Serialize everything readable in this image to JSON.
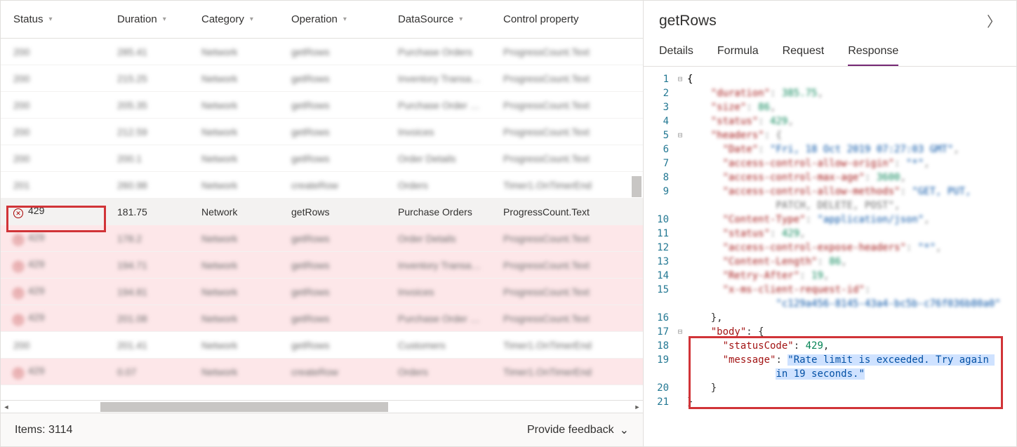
{
  "columns": {
    "status": "Status",
    "duration": "Duration",
    "category": "Category",
    "operation": "Operation",
    "datasource": "DataSource",
    "control": "Control property"
  },
  "rows": [
    {
      "status": "200",
      "duration": "285.41",
      "category": "Network",
      "operation": "getRows",
      "datasource": "Purchase Orders",
      "control": "ProgressCount.Text",
      "err": false,
      "sel": false,
      "blur": true
    },
    {
      "status": "200",
      "duration": "215.25",
      "category": "Network",
      "operation": "getRows",
      "datasource": "Inventory Transa…",
      "control": "ProgressCount.Text",
      "err": false,
      "sel": false,
      "blur": true
    },
    {
      "status": "200",
      "duration": "205.35",
      "category": "Network",
      "operation": "getRows",
      "datasource": "Purchase Order …",
      "control": "ProgressCount.Text",
      "err": false,
      "sel": false,
      "blur": true
    },
    {
      "status": "200",
      "duration": "212.59",
      "category": "Network",
      "operation": "getRows",
      "datasource": "Invoices",
      "control": "ProgressCount.Text",
      "err": false,
      "sel": false,
      "blur": true
    },
    {
      "status": "200",
      "duration": "200.1",
      "category": "Network",
      "operation": "getRows",
      "datasource": "Order Details",
      "control": "ProgressCount.Text",
      "err": false,
      "sel": false,
      "blur": true
    },
    {
      "status": "201",
      "duration": "260.98",
      "category": "Network",
      "operation": "createRow",
      "datasource": "Orders",
      "control": "Timer1.OnTimerEnd",
      "err": false,
      "sel": false,
      "blur": true
    },
    {
      "status": "429",
      "duration": "181.75",
      "category": "Network",
      "operation": "getRows",
      "datasource": "Purchase Orders",
      "control": "ProgressCount.Text",
      "err": true,
      "sel": true,
      "blur": false
    },
    {
      "status": "429",
      "duration": "178.2",
      "category": "Network",
      "operation": "getRows",
      "datasource": "Order Details",
      "control": "ProgressCount.Text",
      "err": true,
      "sel": false,
      "blur": true
    },
    {
      "status": "429",
      "duration": "194.71",
      "category": "Network",
      "operation": "getRows",
      "datasource": "Inventory Transa…",
      "control": "ProgressCount.Text",
      "err": true,
      "sel": false,
      "blur": true
    },
    {
      "status": "429",
      "duration": "194.81",
      "category": "Network",
      "operation": "getRows",
      "datasource": "Invoices",
      "control": "ProgressCount.Text",
      "err": true,
      "sel": false,
      "blur": true
    },
    {
      "status": "429",
      "duration": "201.08",
      "category": "Network",
      "operation": "getRows",
      "datasource": "Purchase Order …",
      "control": "ProgressCount.Text",
      "err": true,
      "sel": false,
      "blur": true
    },
    {
      "status": "200",
      "duration": "201.41",
      "category": "Network",
      "operation": "getRows",
      "datasource": "Customers",
      "control": "Timer1.OnTimerEnd",
      "err": false,
      "sel": false,
      "blur": true
    },
    {
      "status": "429",
      "duration": "0.07",
      "category": "Network",
      "operation": "createRow",
      "datasource": "Orders",
      "control": "Timer1.OnTimerEnd",
      "err": true,
      "sel": false,
      "blur": true
    }
  ],
  "footer": {
    "items": "Items: 3114",
    "feedback": "Provide feedback"
  },
  "detail": {
    "title": "getRows",
    "tabs": [
      "Details",
      "Formula",
      "Request",
      "Response"
    ],
    "activeTab": 3,
    "response": {
      "duration": "385.75",
      "size": "86",
      "status": "429",
      "headers": {
        "Date": "Fri, 18 Oct 2019 07:27:03 GMT",
        "access-control-allow-origin": "*",
        "access-control-max-age": "3600",
        "access-control-allow-methods": "GET, PUT, PATCH, DELETE, POST",
        "Content-Type": "application/json",
        "status": "429",
        "access-control-expose-headers": "*",
        "Content-Length": "86",
        "Retry-After": "19",
        "x-ms-client-request-id": "c129a456-8145-43a4-bc5b-c76f036b80a0"
      },
      "body": {
        "statusCode": 429,
        "message": "Rate limit is exceeded. Try again in 19 seconds."
      }
    }
  }
}
